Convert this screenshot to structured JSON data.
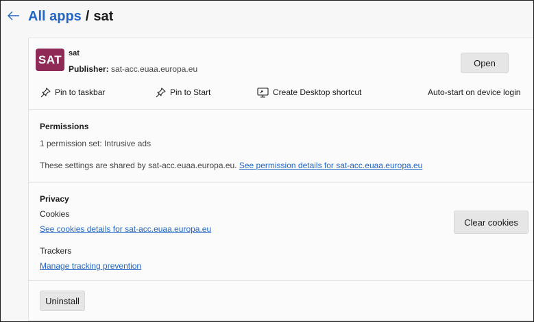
{
  "header": {
    "back_icon": "back-arrow-icon",
    "breadcrumb_link": "All apps",
    "separator": "/",
    "current": "sat"
  },
  "app": {
    "icon_text": "SAT",
    "icon_color": "#8e2a55",
    "name": "sat",
    "publisher_label": "Publisher:",
    "publisher_value": "sat-acc.euaa.europa.eu",
    "open_label": "Open"
  },
  "actions": {
    "pin_taskbar": "Pin to taskbar",
    "pin_start": "Pin to Start",
    "desktop_shortcut": "Create Desktop shortcut",
    "autostart": "Auto-start on device login"
  },
  "permissions": {
    "title": "Permissions",
    "summary": "1 permission set: Intrusive ads",
    "shared_text": "These settings are shared by sat-acc.euaa.europa.eu.",
    "details_link": "See permission details for sat-acc.euaa.europa.eu"
  },
  "privacy": {
    "title": "Privacy",
    "cookies_label": "Cookies",
    "cookies_link": "See cookies details for sat-acc.euaa.europa.eu",
    "clear_cookies": "Clear cookies",
    "trackers_label": "Trackers",
    "tracking_link": "Manage tracking prevention"
  },
  "uninstall": {
    "label": "Uninstall"
  },
  "colors": {
    "link": "#2266c8",
    "brand": "#8e2a55"
  }
}
